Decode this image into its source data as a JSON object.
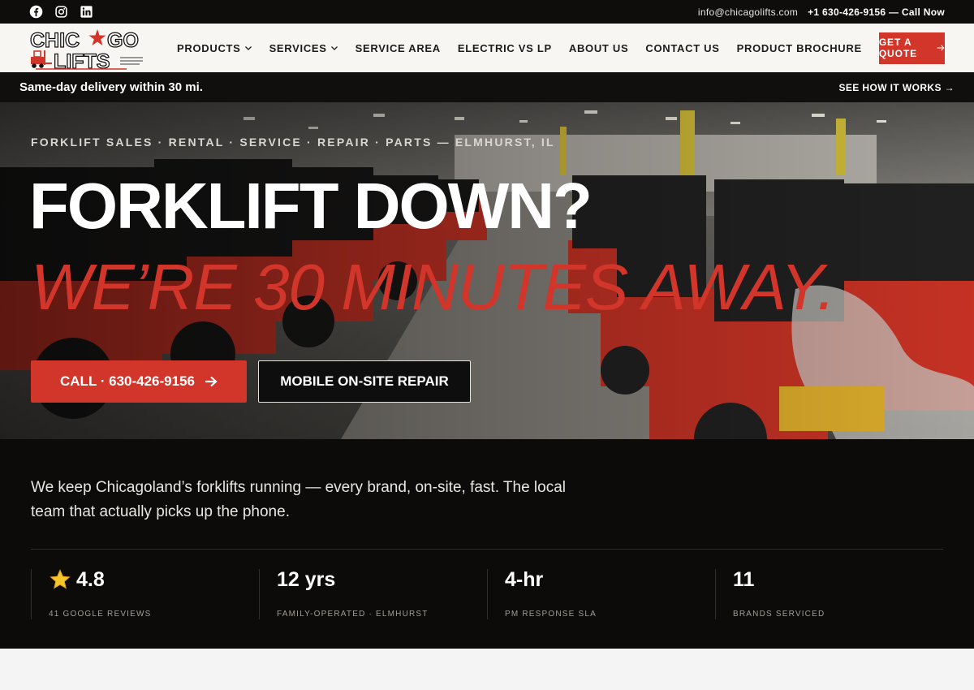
{
  "topbar": {
    "social_icons": [
      "facebook-icon",
      "instagram-icon",
      "linkedin-icon"
    ],
    "email": "info@chicagolifts.com",
    "phone_cta": "+1 630-426-9156 — Call Now"
  },
  "nav": {
    "logo_text_top": "CHIC",
    "logo_text_top_right": "GO",
    "logo_text_bottom": "LIFTS",
    "items": [
      {
        "label": "PRODUCTS",
        "dropdown": true
      },
      {
        "label": "SERVICES",
        "dropdown": true
      },
      {
        "label": "SERVICE AREA",
        "dropdown": false
      },
      {
        "label": "ELECTRIC VS LP",
        "dropdown": false
      },
      {
        "label": "ABOUT US",
        "dropdown": false
      },
      {
        "label": "CONTACT US",
        "dropdown": false
      },
      {
        "label": "PRODUCT BROCHURE",
        "dropdown": false
      }
    ],
    "quote_label": "GET A QUOTE"
  },
  "strip": {
    "message": "Same-day delivery within 30 mi.",
    "link": "SEE HOW IT WORKS →"
  },
  "hero": {
    "eyebrow": "FORKLIFT SALES · RENTAL · SERVICE · REPAIR · PARTS — ELMHURST, IL",
    "headline": "FORKLIFT DOWN?",
    "subheadline": "WE’RE 30 MINUTES AWAY.",
    "call_button": "CALL · 630-426-9156",
    "repair_button": "MOBILE ON-SITE REPAIR"
  },
  "intro": {
    "lead": "We keep Chicagoland’s forklifts running — every brand, on-site, fast. The local team that actually picks up the phone."
  },
  "stats": [
    {
      "value": "4.8",
      "label": "41 GOOGLE REVIEWS",
      "icon": "star-icon"
    },
    {
      "value": "12 yrs",
      "label": "FAMILY-OPERATED · ELMHURST"
    },
    {
      "value": "4-hr",
      "label": "PM RESPONSE SLA"
    },
    {
      "value": "11",
      "label": "BRANDS SERVICED"
    }
  ],
  "colors": {
    "accent": "#d2352a",
    "dark": "#0c0b0a"
  }
}
